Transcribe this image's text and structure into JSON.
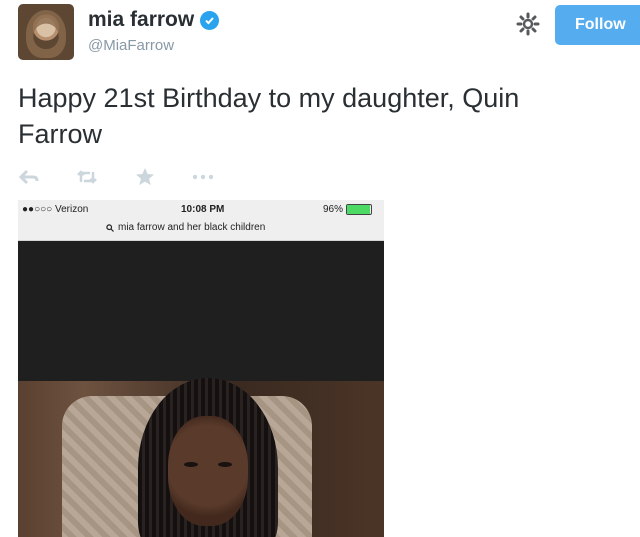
{
  "user": {
    "name": "mia farrow",
    "handle": "@MiaFarrow",
    "verified_icon": "verified-badge-icon"
  },
  "header": {
    "follow_label": "Follow",
    "settings_icon": "gear-icon"
  },
  "tweet": {
    "line1": "Happy 21st Birthday to my daughter, Quin",
    "line2": "Farrow"
  },
  "actions": [
    {
      "name": "reply",
      "icon": "reply-icon"
    },
    {
      "name": "retweet",
      "icon": "retweet-icon"
    },
    {
      "name": "favorite",
      "icon": "star-icon"
    },
    {
      "name": "more",
      "icon": "more-icon"
    }
  ],
  "photo": {
    "carrier": "●●○○○ Verizon",
    "time": "10:08 PM",
    "battery": "96%",
    "battery_level": 0.96,
    "search_query": "mia farrow and her black children"
  },
  "colors": {
    "follow_bg": "#55acee",
    "verified": "#2aa3ef",
    "handle": "#8899a6",
    "action_icons": "#ccd6dd"
  }
}
